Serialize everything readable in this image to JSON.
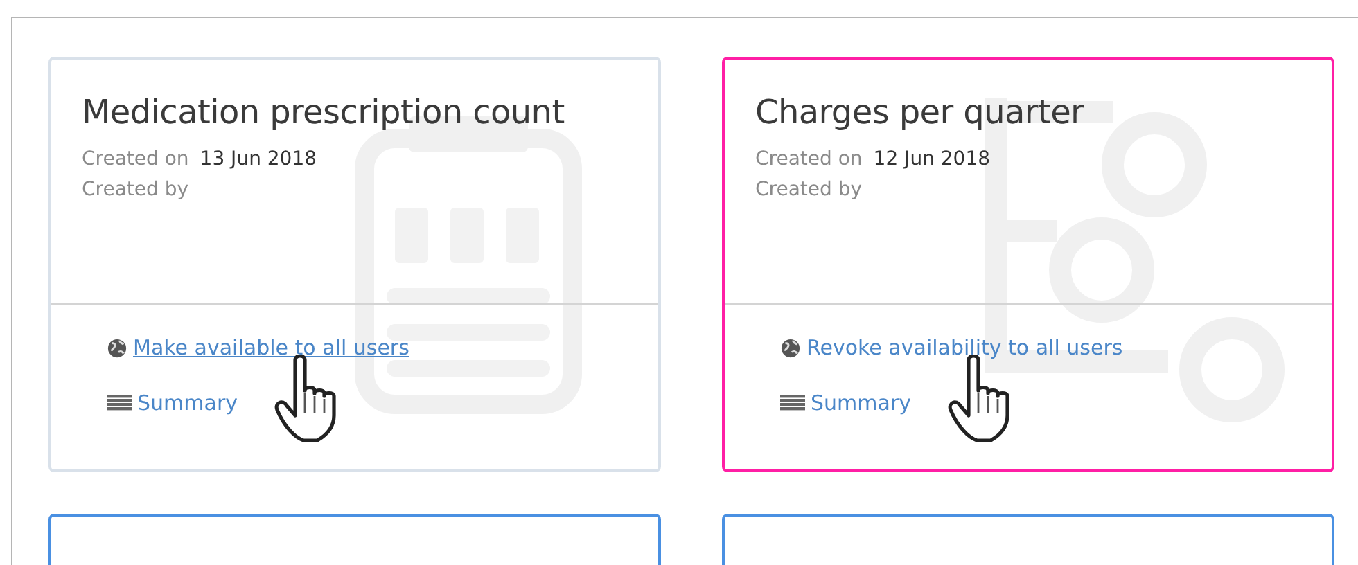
{
  "cards": [
    {
      "title": "Medication prescription count",
      "color": "#d9e1ea",
      "kind": "clipboard",
      "created_on_label": "Created on",
      "created_on": "13 Jun 2018",
      "created_by_label": "Created by",
      "actions": [
        {
          "kind": "globe",
          "label": "Make available to all users",
          "underlined": true,
          "cursor": true
        },
        {
          "kind": "list",
          "label": "Summary",
          "underlined": false,
          "cursor": false
        }
      ]
    },
    {
      "title": "Charges per quarter",
      "color": "#ff1fa5",
      "kind": "flow",
      "created_on_label": "Created on",
      "created_on": "12 Jun 2018",
      "created_by_label": "Created by",
      "actions": [
        {
          "kind": "globe",
          "label": "Revoke availability to all users",
          "underlined": false,
          "cursor": true
        },
        {
          "kind": "list",
          "label": "Summary",
          "underlined": false,
          "cursor": false
        }
      ]
    },
    {
      "color": "#4a90e2"
    },
    {
      "color": "#4a90e2"
    }
  ]
}
